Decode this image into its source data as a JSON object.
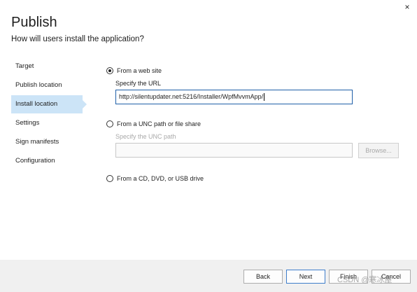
{
  "window": {
    "close_glyph": "×"
  },
  "header": {
    "title": "Publish",
    "subtitle": "How will users install the application?"
  },
  "nav": {
    "items": [
      {
        "label": "Target",
        "active": false
      },
      {
        "label": "Publish location",
        "active": false
      },
      {
        "label": "Install location",
        "active": true
      },
      {
        "label": "Settings",
        "active": false
      },
      {
        "label": "Sign manifests",
        "active": false
      },
      {
        "label": "Configuration",
        "active": false
      }
    ]
  },
  "options": {
    "web": {
      "label": "From a web site",
      "checked": true,
      "url_label": "Specify the URL",
      "url_value": "http://silentupdater.net:5216/Installer/WpfMvvmApp/"
    },
    "unc": {
      "label": "From a UNC path or file share",
      "checked": false,
      "path_label": "Specify the UNC path",
      "path_value": "",
      "browse_label": "Browse..."
    },
    "cd": {
      "label": "From a CD, DVD, or USB drive",
      "checked": false
    }
  },
  "footer": {
    "back_label": "Back",
    "next_label": "Next",
    "finish_label": "Finish",
    "cancel_label": "Cancel"
  },
  "watermark": {
    "text": "CSDN @寒冰屋"
  },
  "colors": {
    "accent": "#1f5fa8",
    "nav_active_bg": "#cce4f7",
    "footer_bg": "#f0f0f0"
  }
}
